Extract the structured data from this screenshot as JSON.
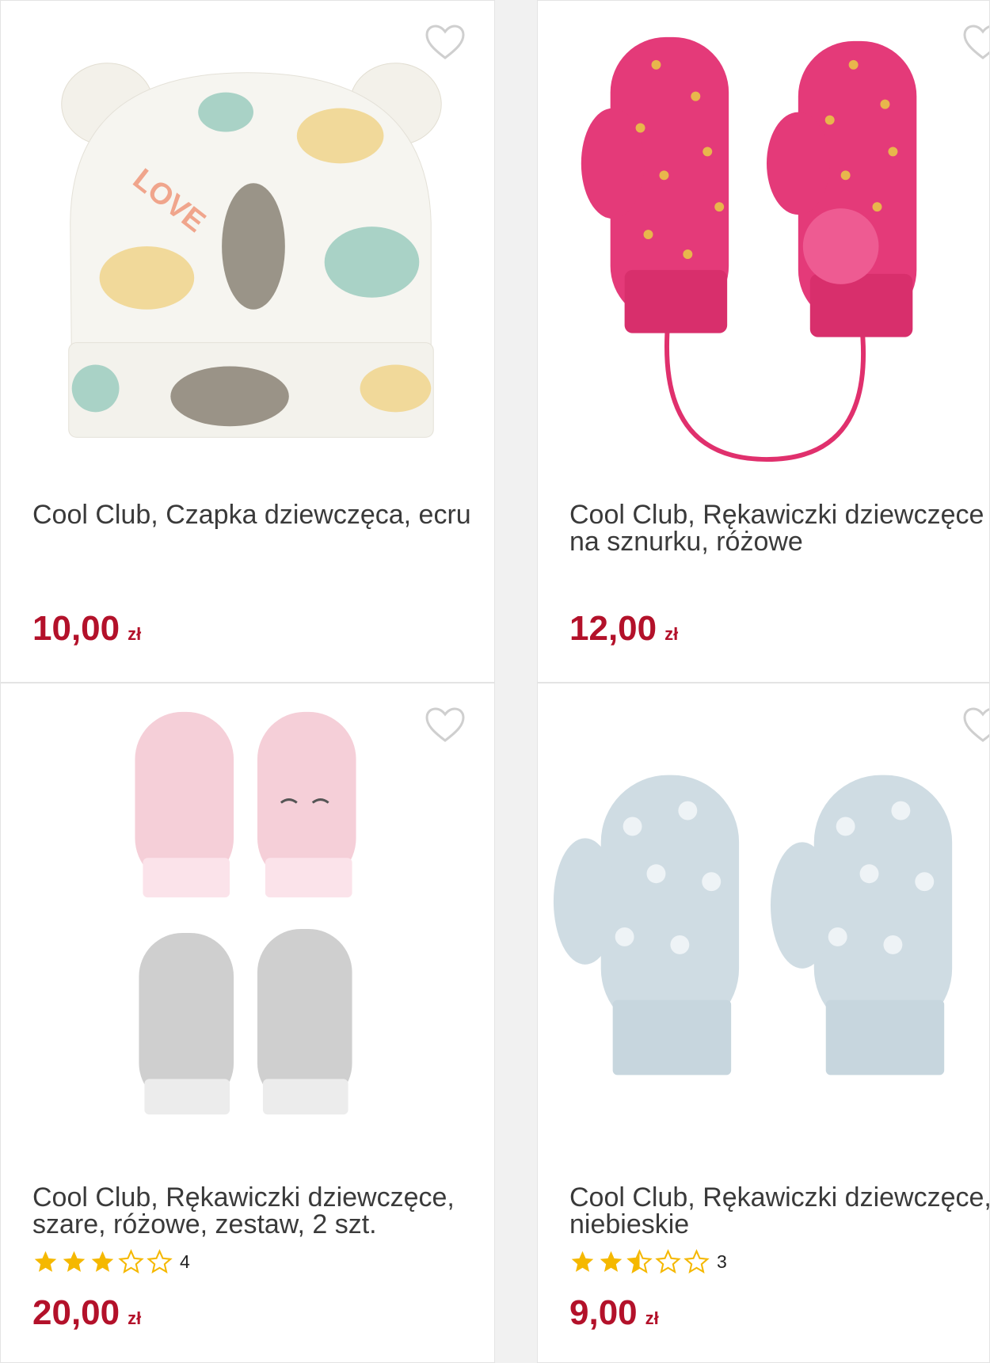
{
  "products": [
    {
      "title": "Cool Club, Czapka dziewczęca, ecru",
      "price": "10,00",
      "currency": "zł",
      "favorite_icon": "heart-outline-icon"
    },
    {
      "title": "Cool Club, Rękawiczki dziewczęce na sznurku, różowe",
      "price": "12,00",
      "currency": "zł",
      "favorite_icon": "heart-outline-icon"
    },
    {
      "title": "Cool Club, Rękawiczki dziewczęce, szare, różowe, zestaw, 2 szt.",
      "rating": 3,
      "rating_count": "4",
      "price": "20,00",
      "currency": "zł",
      "favorite_icon": "heart-outline-icon"
    },
    {
      "title": "Cool Club, Rękawiczki dziewczęce, niebieskie",
      "rating": 2.5,
      "rating_count": "3",
      "price": "9,00",
      "currency": "zł",
      "favorite_icon": "heart-outline-icon"
    }
  ],
  "colors": {
    "price": "#b3112a",
    "star": "#f5b800",
    "text": "#3a3a3a"
  }
}
